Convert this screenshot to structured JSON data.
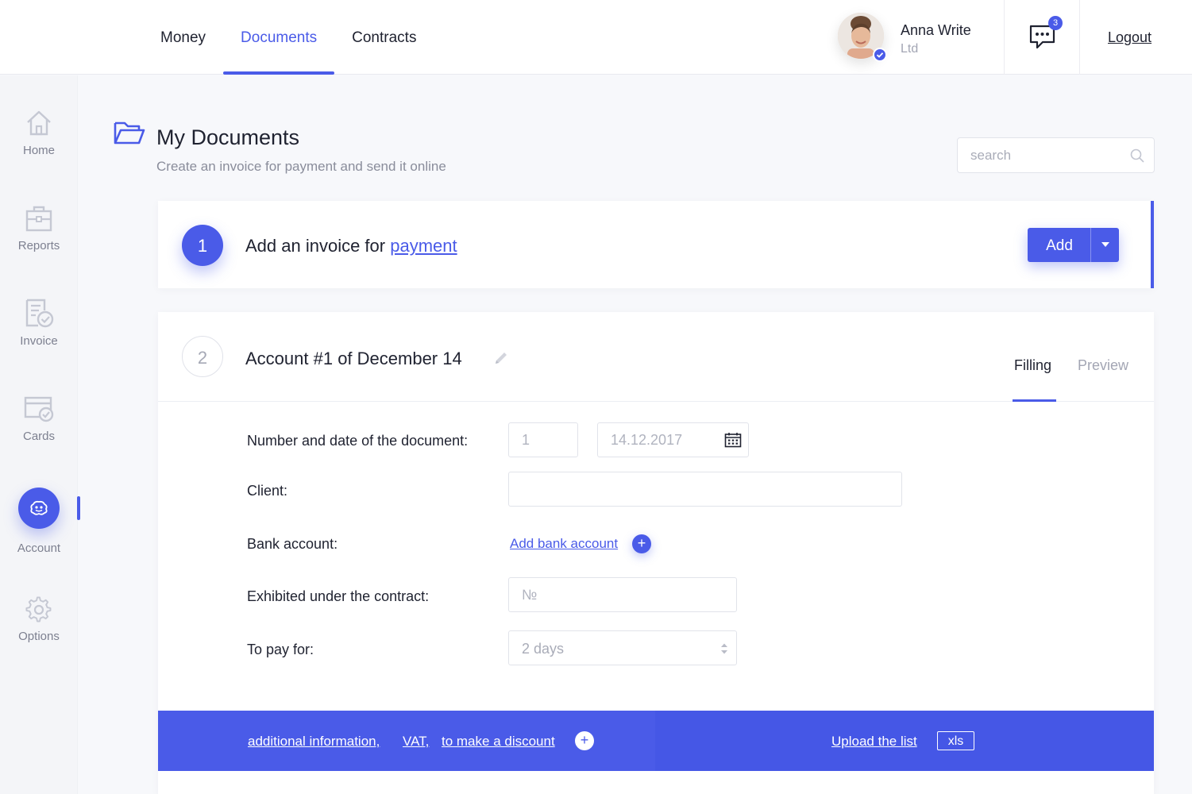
{
  "nav": {
    "items": [
      {
        "label": "Money"
      },
      {
        "label": "Documents",
        "active": true
      },
      {
        "label": "Contracts"
      }
    ]
  },
  "user": {
    "name": "Anna Write",
    "company": "Ltd"
  },
  "messages": {
    "count": "3"
  },
  "logout": "Logout",
  "sidebar": {
    "items": [
      {
        "label": "Home",
        "icon": "home-icon"
      },
      {
        "label": "Reports",
        "icon": "briefcase-icon"
      },
      {
        "label": "Invoice",
        "icon": "invoice-icon"
      },
      {
        "label": "Cards",
        "icon": "card-icon"
      },
      {
        "label": "Account",
        "icon": "account-icon",
        "active": true
      },
      {
        "label": "Options",
        "icon": "gear-icon"
      }
    ]
  },
  "page": {
    "title": "My Documents",
    "subtitle": "Create an invoice for payment and send it online"
  },
  "search": {
    "placeholder": "search",
    "value": ""
  },
  "step1": {
    "number": "1",
    "title_prefix": "Add an invoice for",
    "title_link": "payment",
    "add_button": "Add"
  },
  "step2": {
    "number": "2",
    "title": "Account #1 of December 14",
    "tabs": [
      {
        "label": "Filling",
        "active": true
      },
      {
        "label": "Preview"
      }
    ],
    "fields": {
      "number_date_label": "Number and date of the document:",
      "number_placeholder": "1",
      "date_placeholder": "14.12.2017",
      "client_label": "Client:",
      "client_value": "",
      "bank_label": "Bank account:",
      "bank_link": "Add bank account",
      "contract_label": "Exhibited under the contract:",
      "contract_placeholder": "№",
      "pay_label": "To pay for:",
      "pay_value": "2 days"
    }
  },
  "bottom_bar": {
    "additional": "additional information,",
    "vat": "VAT,",
    "discount": "to make a discount",
    "plus": "+",
    "upload": "Upload the list",
    "xls": "xls"
  },
  "colors": {
    "accent": "#4a5be8",
    "text": "#1f2230",
    "muted": "#a3a6b4"
  }
}
